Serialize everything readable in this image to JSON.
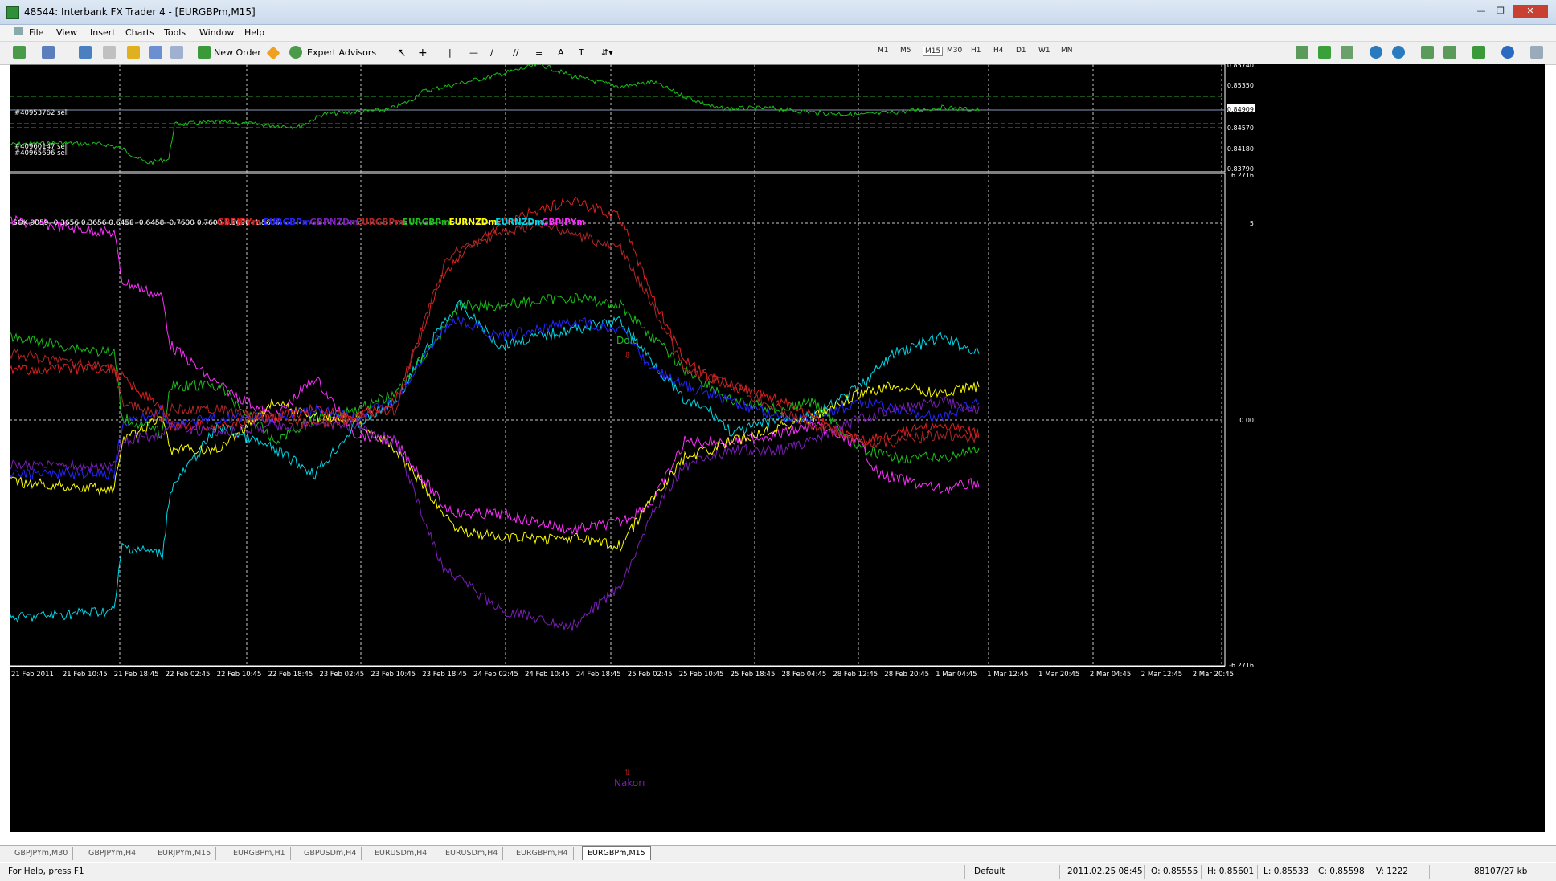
{
  "window": {
    "title": "48544: Interbank FX Trader 4 - [EURGBPm,M15]"
  },
  "menu": [
    "File",
    "View",
    "Insert",
    "Charts",
    "Tools",
    "Window",
    "Help"
  ],
  "toolbar": {
    "new_order": "New Order",
    "expert_advisors": "Expert Advisors",
    "timeframes": [
      "M1",
      "M5",
      "M15",
      "M30",
      "H1",
      "H4",
      "D1",
      "W1",
      "MN"
    ],
    "active_timeframe": "M15"
  },
  "price_chart": {
    "orders": [
      "#40953762 sell",
      "#40960147 sell",
      "#40965696 sell"
    ],
    "price_labels": [
      "0.85740",
      "0.85350",
      "0.84909",
      "0.84570",
      "0.84180",
      "0.83790"
    ],
    "current_price": "0.84909"
  },
  "indicator": {
    "header": "SOK 9059 -0.3656 0.3656 0.6458 -0.6458 -0.7600 0.7600 1.5636 -1.5636",
    "legend": [
      {
        "name": "GBPJPYm",
        "color": "#e02020"
      },
      {
        "name": "EURGBPm",
        "color": "#2424ff"
      },
      {
        "name": "GBPNZDm",
        "color": "#7a1fb8"
      },
      {
        "name": "EURGBPm",
        "color": "#b02828"
      },
      {
        "name": "EURGBPm",
        "color": "#19c019"
      },
      {
        "name": "EURNZDm",
        "color": "#ffff00"
      },
      {
        "name": "EURNZDm",
        "color": "#00d8e8"
      },
      {
        "name": "GBPJPYm",
        "color": "#ff30ff"
      }
    ],
    "scale_labels": [
      "6.2716",
      "5",
      "0.00",
      "-6.2716"
    ],
    "annotations": [
      {
        "text": "Dolu",
        "color": "#19c019"
      },
      {
        "text": "Nakorı",
        "color": "#7a1fb8"
      }
    ]
  },
  "time_axis": [
    "21 Feb 2011",
    "21 Feb 10:45",
    "21 Feb 18:45",
    "22 Feb 02:45",
    "22 Feb 10:45",
    "22 Feb 18:45",
    "23 Feb 02:45",
    "23 Feb 10:45",
    "23 Feb 18:45",
    "24 Feb 02:45",
    "24 Feb 10:45",
    "24 Feb 18:45",
    "25 Feb 02:45",
    "25 Feb 10:45",
    "25 Feb 18:45",
    "28 Feb 04:45",
    "28 Feb 12:45",
    "28 Feb 20:45",
    "1 Mar 04:45",
    "1 Mar 12:45",
    "1 Mar 20:45",
    "2 Mar 04:45",
    "2 Mar 12:45",
    "2 Mar 20:45"
  ],
  "tabs": [
    "GBPJPYm,M30",
    "GBPJPYm,H4",
    "EURJPYm,M15",
    "EURGBPm,H1",
    "GBPUSDm,H4",
    "EURUSDm,H4",
    "EURUSDm,H4",
    "EURGBPm,H4",
    "EURGBPm,M15"
  ],
  "active_tab": "EURGBPm,M15",
  "status": {
    "help": "For Help, press F1",
    "profile": "Default",
    "datetime": "2011.02.25 08:45",
    "open": "O: 0.85555",
    "high": "H: 0.85601",
    "low": "L: 0.85533",
    "close": "C: 0.85598",
    "volume": "V: 1222",
    "traffic": "88107/27 kb"
  }
}
